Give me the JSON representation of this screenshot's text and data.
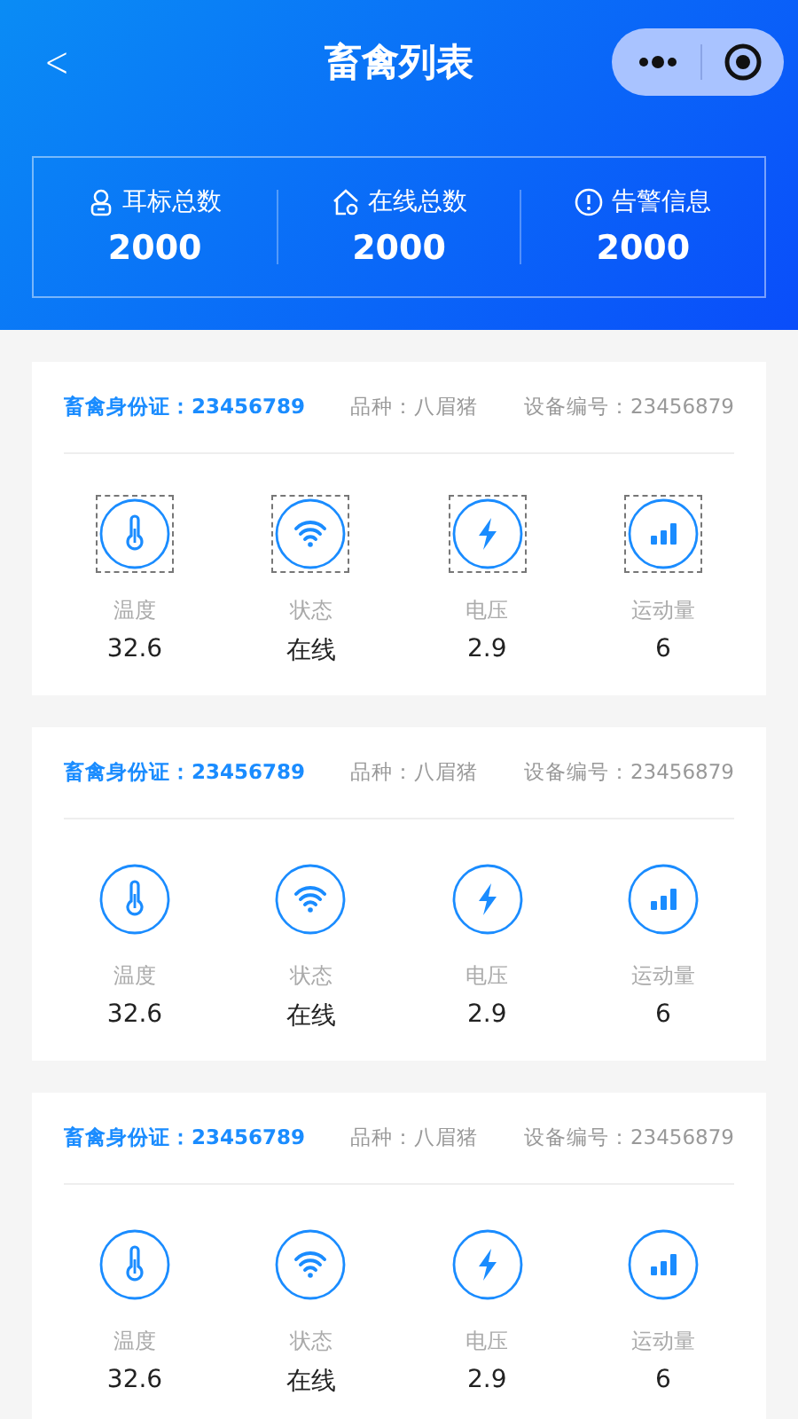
{
  "nav": {
    "back": "<",
    "title": "畜禽列表"
  },
  "summary": [
    {
      "kind": "tag",
      "label": "耳标总数",
      "value": "2000"
    },
    {
      "kind": "home",
      "label": "在线总数",
      "value": "2000"
    },
    {
      "kind": "alert",
      "label": "告警信息",
      "value": "2000"
    }
  ],
  "cards": [
    {
      "outlined": true,
      "id_label": "畜禽身份证：23456789",
      "breed": "品种：八眉猪",
      "device": "设备编号：23456879",
      "metrics": [
        {
          "kind": "temp",
          "label": "温度",
          "value": "32.6"
        },
        {
          "kind": "wifi",
          "label": "状态",
          "value": "在线"
        },
        {
          "kind": "bolt",
          "label": "电压",
          "value": "2.9"
        },
        {
          "kind": "bars",
          "label": "运动量",
          "value": "6"
        }
      ]
    },
    {
      "outlined": false,
      "id_label": "畜禽身份证：23456789",
      "breed": "品种：八眉猪",
      "device": "设备编号：23456879",
      "metrics": [
        {
          "kind": "temp",
          "label": "温度",
          "value": "32.6"
        },
        {
          "kind": "wifi",
          "label": "状态",
          "value": "在线"
        },
        {
          "kind": "bolt",
          "label": "电压",
          "value": "2.9"
        },
        {
          "kind": "bars",
          "label": "运动量",
          "value": "6"
        }
      ]
    },
    {
      "outlined": false,
      "id_label": "畜禽身份证：23456789",
      "breed": "品种：八眉猪",
      "device": "设备编号：23456879",
      "metrics": [
        {
          "kind": "temp",
          "label": "温度",
          "value": "32.6"
        },
        {
          "kind": "wifi",
          "label": "状态",
          "value": "在线"
        },
        {
          "kind": "bolt",
          "label": "电压",
          "value": "2.9"
        },
        {
          "kind": "bars",
          "label": "运动量",
          "value": "6"
        }
      ]
    }
  ]
}
